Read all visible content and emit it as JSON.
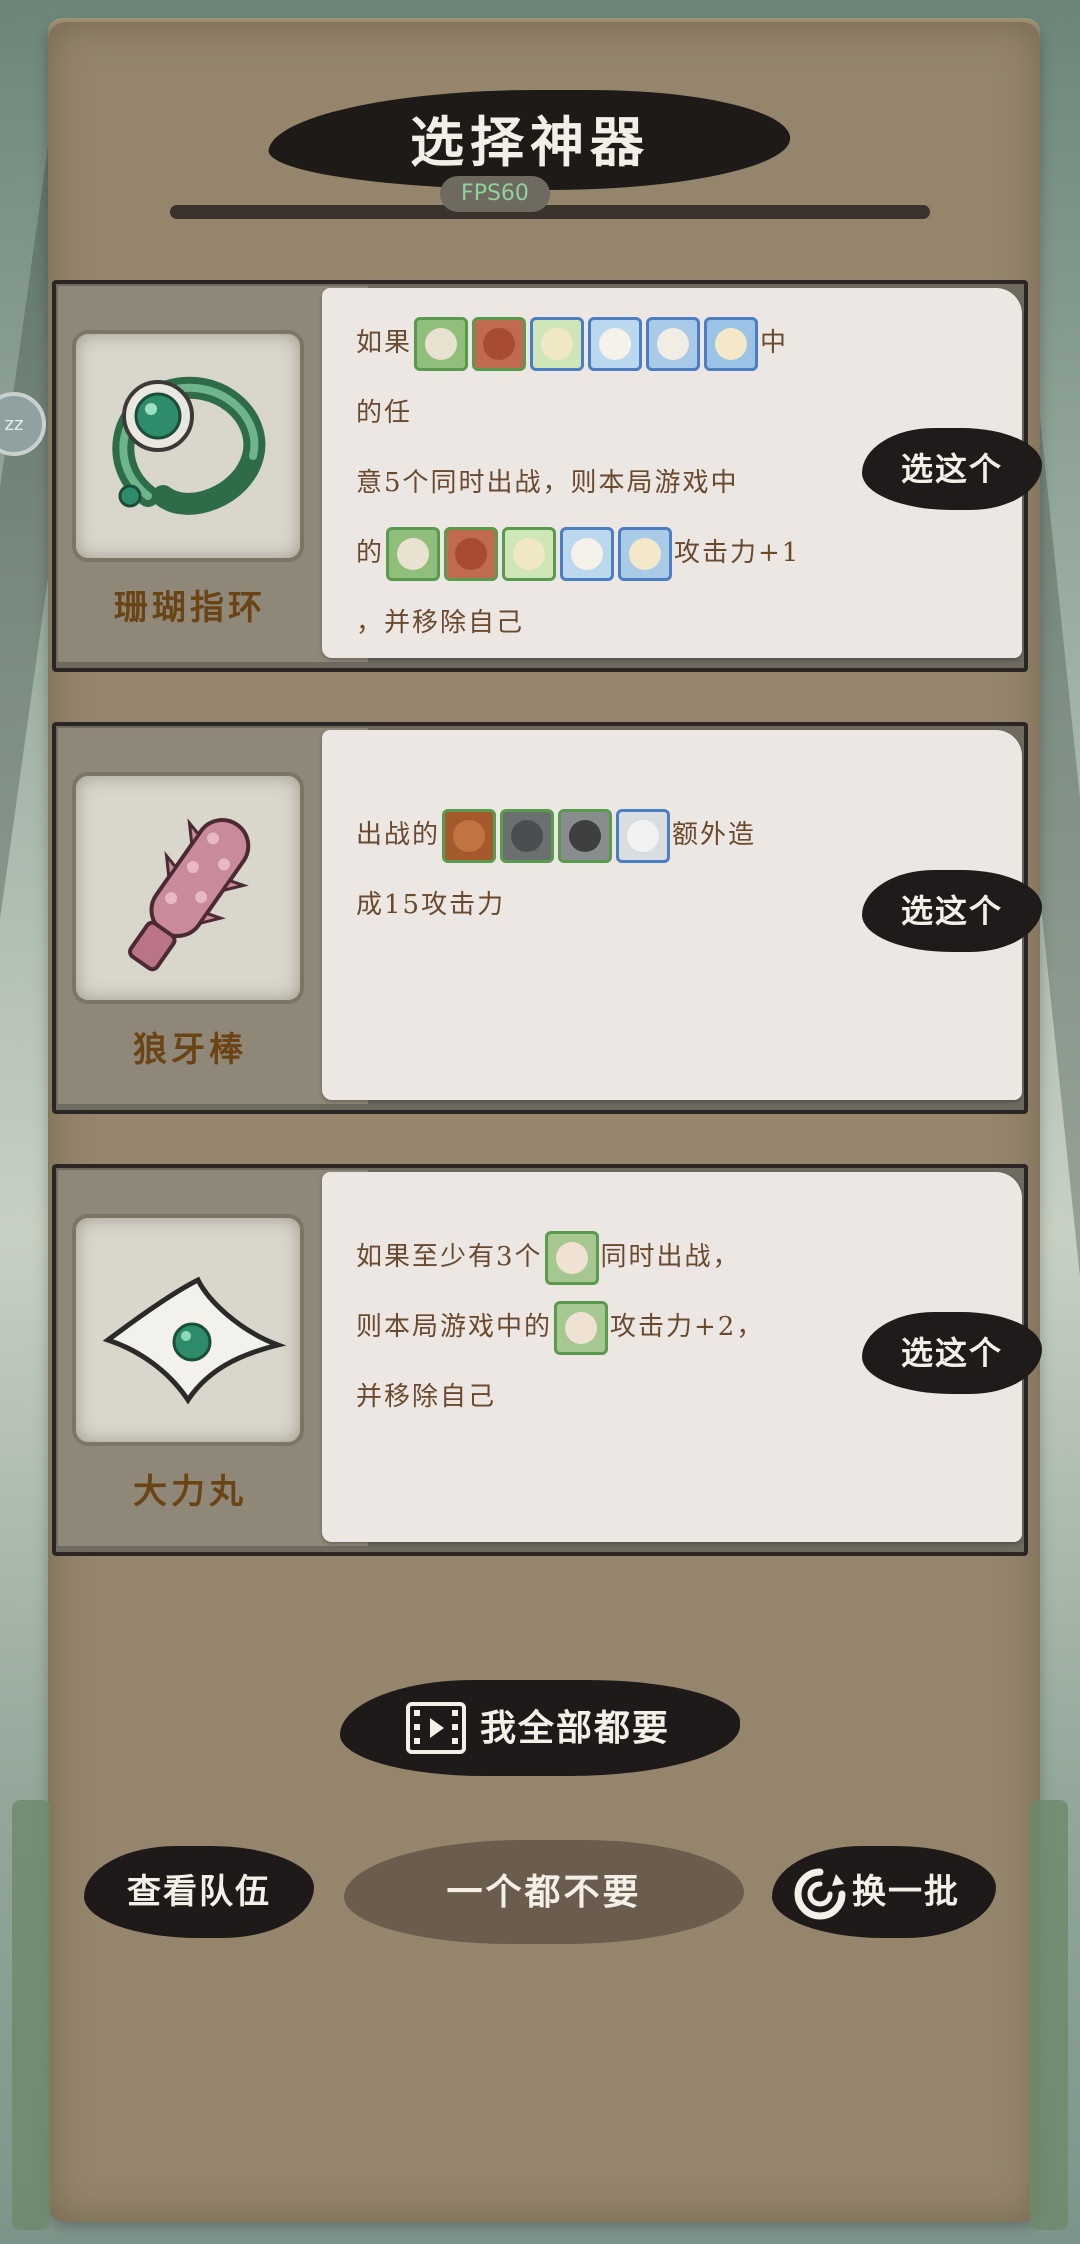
{
  "header": {
    "title": "选择神器",
    "fps": "FPS60"
  },
  "cards": [
    {
      "name": "珊瑚指环",
      "icon": "coral-ring-icon",
      "desc": {
        "l1_pre": "如果",
        "l1_post": "中的任",
        "l2": "意5个同时出战，则本局游戏中",
        "l3_pre": "的",
        "l3_post": "攻击力+1",
        "l4": "，并移除自己"
      },
      "button": "选这个"
    },
    {
      "name": "狼牙棒",
      "icon": "spiked-club-icon",
      "desc": {
        "l1_pre": "出战的",
        "l1_post": "额外造",
        "l2": "成15攻击力"
      },
      "button": "选这个"
    },
    {
      "name": "大力丸",
      "icon": "power-pill-icon",
      "desc": {
        "l1_pre": "如果至少有3个",
        "l1_post": "同时出战，",
        "l2_pre": "则本局游戏中的",
        "l2_post": "攻击力+2，",
        "l3": "并移除自己"
      },
      "button": "选这个"
    }
  ],
  "actions": {
    "take_all": "我全部都要",
    "view_team": "查看队伍",
    "take_none": "一个都不要",
    "refresh": "换一批"
  }
}
